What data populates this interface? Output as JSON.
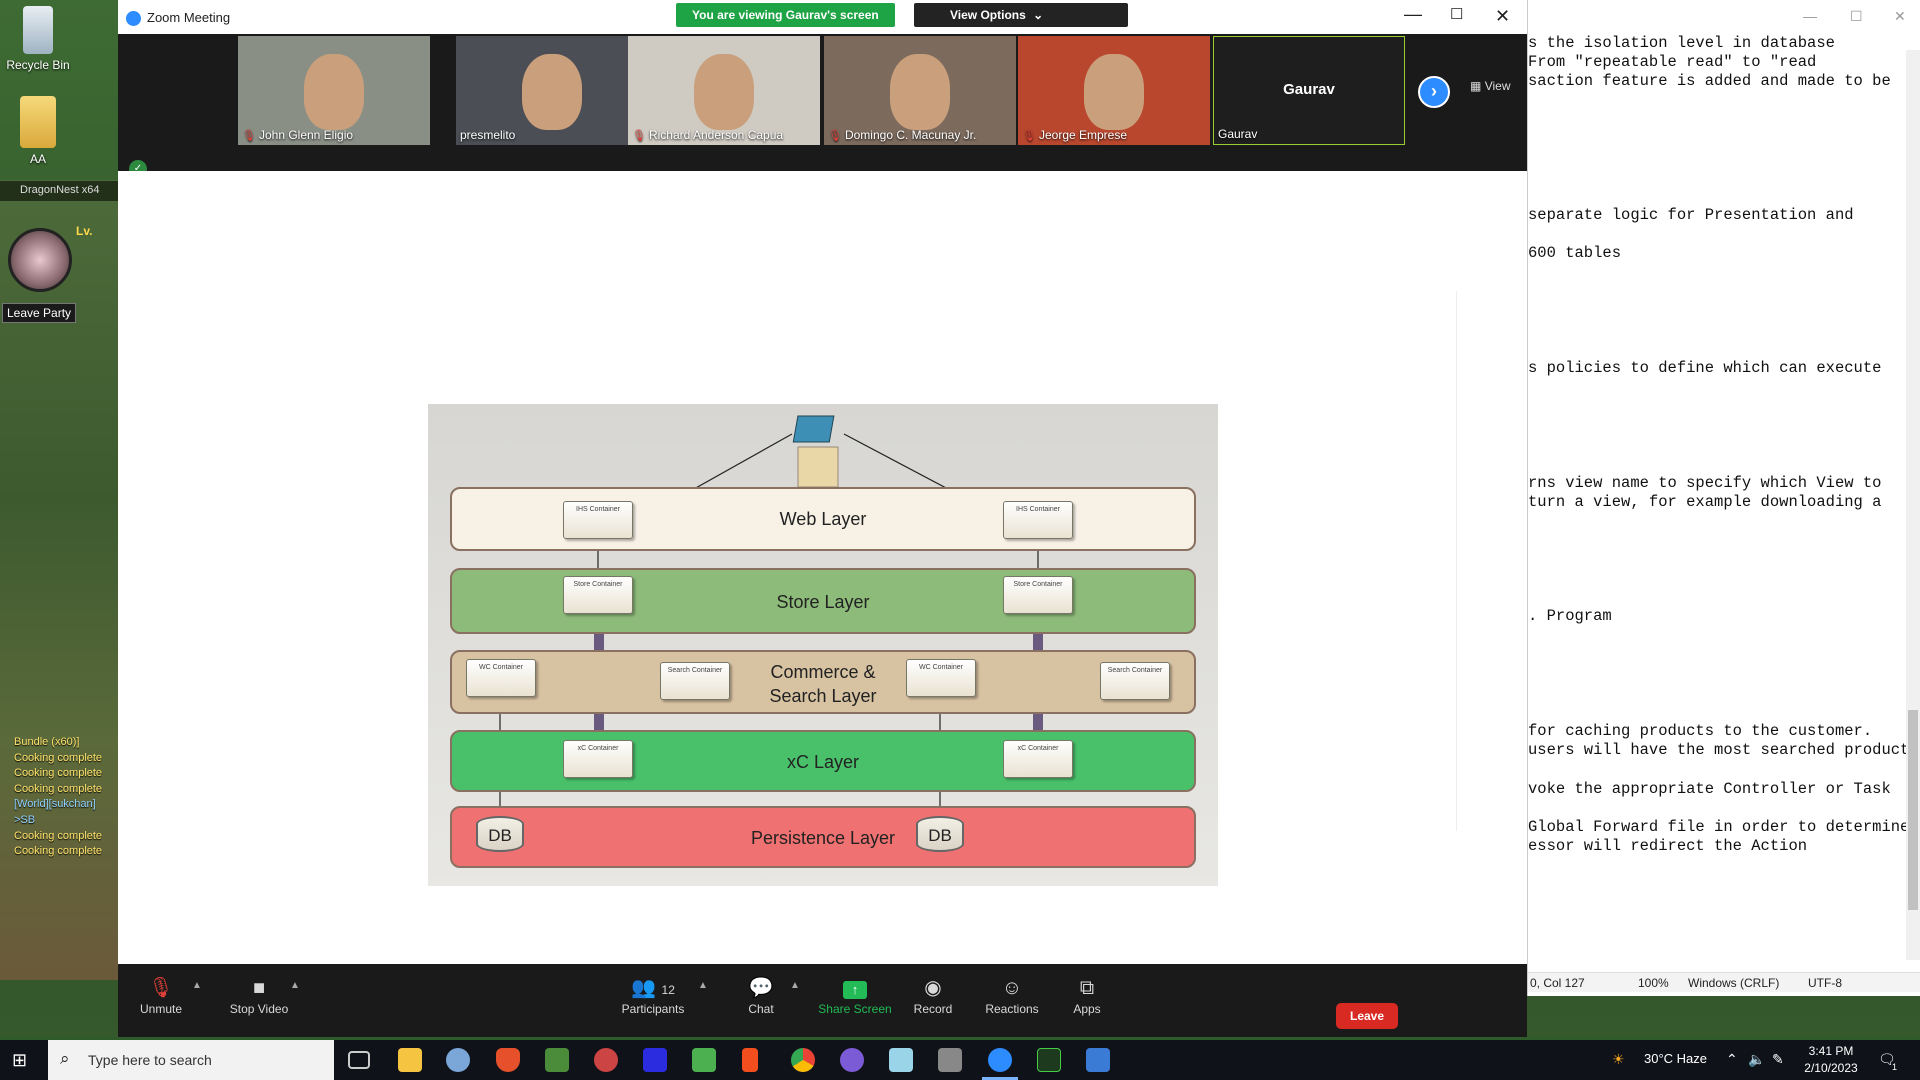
{
  "desktop": {
    "icons": [
      {
        "label": "Recycle Bin"
      },
      {
        "label": "AA"
      }
    ],
    "game": {
      "title": "DragonNest x64",
      "level_label": "Lv.",
      "leave_party": "Leave Party",
      "chat": [
        {
          "text": "Bundle (x60)]",
          "kind": "sys"
        },
        {
          "text": "Cooking complete",
          "kind": "sys"
        },
        {
          "text": "Cooking complete",
          "kind": "sys"
        },
        {
          "text": "Cooking complete",
          "kind": "sys"
        },
        {
          "text": "[World][sukchan]",
          "kind": "world"
        },
        {
          "text": ">SB",
          "kind": "world"
        },
        {
          "text": "Cooking complete",
          "kind": "sys"
        },
        {
          "text": "Cooking complete",
          "kind": "sys"
        }
      ]
    }
  },
  "zoom": {
    "window_title": "Zoom Meeting",
    "viewing_banner": "You are viewing Gaurav's screen",
    "view_options": "View Options",
    "view_label": "View",
    "participants": [
      {
        "name": "John Glenn Eligio",
        "muted": true,
        "bg": "#8a8f86",
        "face": true
      },
      {
        "name": "presmelito",
        "muted": false,
        "bg": "#4b4f55",
        "face": true
      },
      {
        "name": "Richard Anderson Capua",
        "muted": true,
        "bg": "#cfcac2",
        "face": true
      },
      {
        "name": "Domingo C. Macunay Jr.",
        "muted": true,
        "bg": "#7c6a5d",
        "face": true
      },
      {
        "name": "Jeorge Emprese",
        "muted": true,
        "bg": "#b8472e",
        "face": true
      },
      {
        "name": "Gaurav",
        "muted": false,
        "bg": "#1e1e1e",
        "face": false,
        "center_label": "Gaurav"
      }
    ],
    "diagram": {
      "layers": [
        {
          "label": "Web Layer",
          "color": "#f7f1e6"
        },
        {
          "label": "Store Layer",
          "color": "#8dbb7a"
        },
        {
          "label": "Commerce &\nSearch Layer",
          "color": "#d7c2a2"
        },
        {
          "label": "xC Layer",
          "color": "#49c16b"
        },
        {
          "label": "Persistence Layer",
          "color": "#f07171"
        }
      ],
      "containers": {
        "ihs": "IHS Container",
        "store": "Store Container",
        "wc": "WC Container",
        "search": "Search Container",
        "xc": "xC Container"
      },
      "db_label": "DB"
    },
    "controls": {
      "unmute": "Unmute",
      "stop_video": "Stop Video",
      "participants": "Participants",
      "participant_count": "12",
      "chat": "Chat",
      "share_screen": "Share Screen",
      "record": "Record",
      "reactions": "Reactions",
      "apps": "Apps",
      "leave": "Leave"
    }
  },
  "notepad": {
    "lines": [
      "s the isolation level in database",
      "From \"repeatable read\" to \"read",
      "saction feature is added and made to be",
      "separate logic for Presentation and",
      "600 tables",
      "s policies to define which can execute",
      "rns view name to specify which View to",
      "turn a view, for example downloading a",
      ". Program",
      "for caching products to the customer.",
      "users will have the most searched product",
      "voke the appropriate Controller or Task",
      "Global Forward file in order to determine",
      "essor will redirect the Action"
    ],
    "status": {
      "position": "0, Col 127",
      "zoom": "100%",
      "line_ending": "Windows (CRLF)",
      "encoding": "UTF-8"
    }
  },
  "taskbar": {
    "search_placeholder": "Type here to search",
    "weather": "30°C  Haze",
    "time": "3:41 PM",
    "date": "2/10/2023",
    "notification_count": "1"
  }
}
